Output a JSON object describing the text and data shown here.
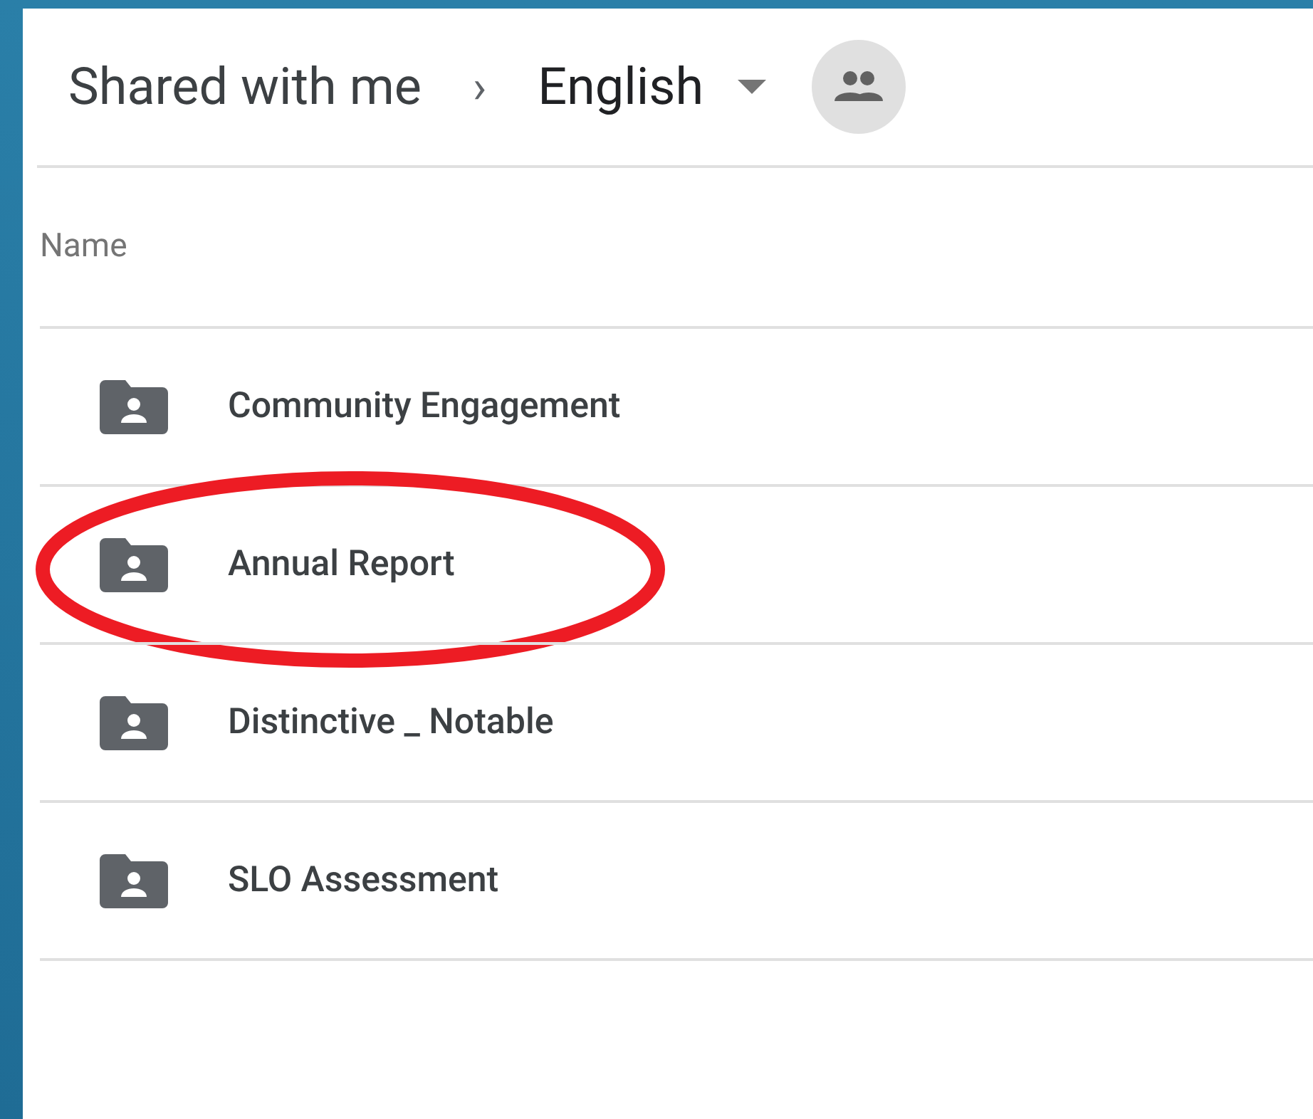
{
  "breadcrumb": {
    "parent": "Shared with me",
    "separator": "›",
    "current": "English"
  },
  "column_header": "Name",
  "folders": [
    {
      "name": "Community Engagement",
      "highlighted": false
    },
    {
      "name": "Annual Report",
      "highlighted": true
    },
    {
      "name": "Distinctive _ Notable",
      "highlighted": false
    },
    {
      "name": "SLO Assessment",
      "highlighted": false
    }
  ]
}
